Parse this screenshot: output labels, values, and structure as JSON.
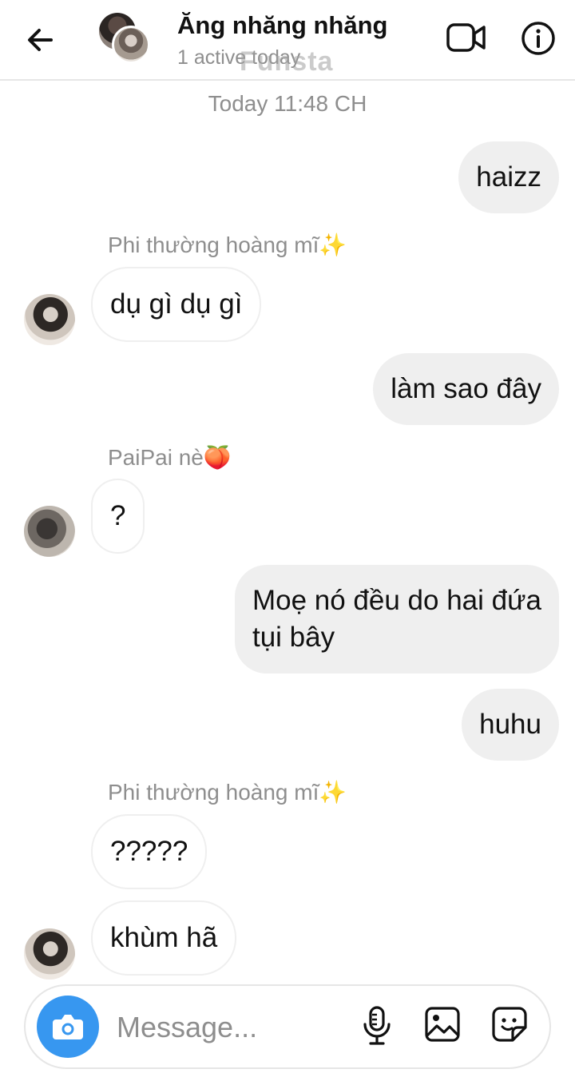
{
  "header": {
    "title": "Ăng nhăng nhăng",
    "subtitle": "1 active today",
    "watermark": "Funsta",
    "icons": {
      "back": "arrow-left-icon",
      "video": "video-call-icon",
      "info": "info-icon"
    }
  },
  "conversation": {
    "timestamp": "Today 11:48 CH",
    "messages": [
      {
        "direction": "outgoing",
        "text": "haizz"
      },
      {
        "direction": "incoming",
        "sender": "Phi thường hoàng mĩ✨",
        "text": "dụ gì dụ gì"
      },
      {
        "direction": "outgoing",
        "text": "làm sao đây"
      },
      {
        "direction": "incoming",
        "sender": "PaiPai nè🍑",
        "text": "?"
      },
      {
        "direction": "outgoing",
        "text": "Moẹ nó đều do hai đứa tụi bây",
        "lines": [
          "Moẹ nó đều do hai đứa",
          "tụi bây"
        ]
      },
      {
        "direction": "outgoing",
        "text": "huhu"
      },
      {
        "direction": "incoming",
        "sender": "Phi thường hoàng mĩ✨",
        "text": "?????"
      },
      {
        "direction": "incoming",
        "text": "khùm hã"
      }
    ]
  },
  "composer": {
    "placeholder": "Message...",
    "icons": {
      "camera": "camera-icon",
      "mic": "microphone-icon",
      "gallery": "image-icon",
      "sticker": "sticker-icon"
    }
  },
  "colors": {
    "accent": "#3797f0",
    "outgoing_bubble": "#efefef",
    "muted_text": "#8e8e8e"
  }
}
